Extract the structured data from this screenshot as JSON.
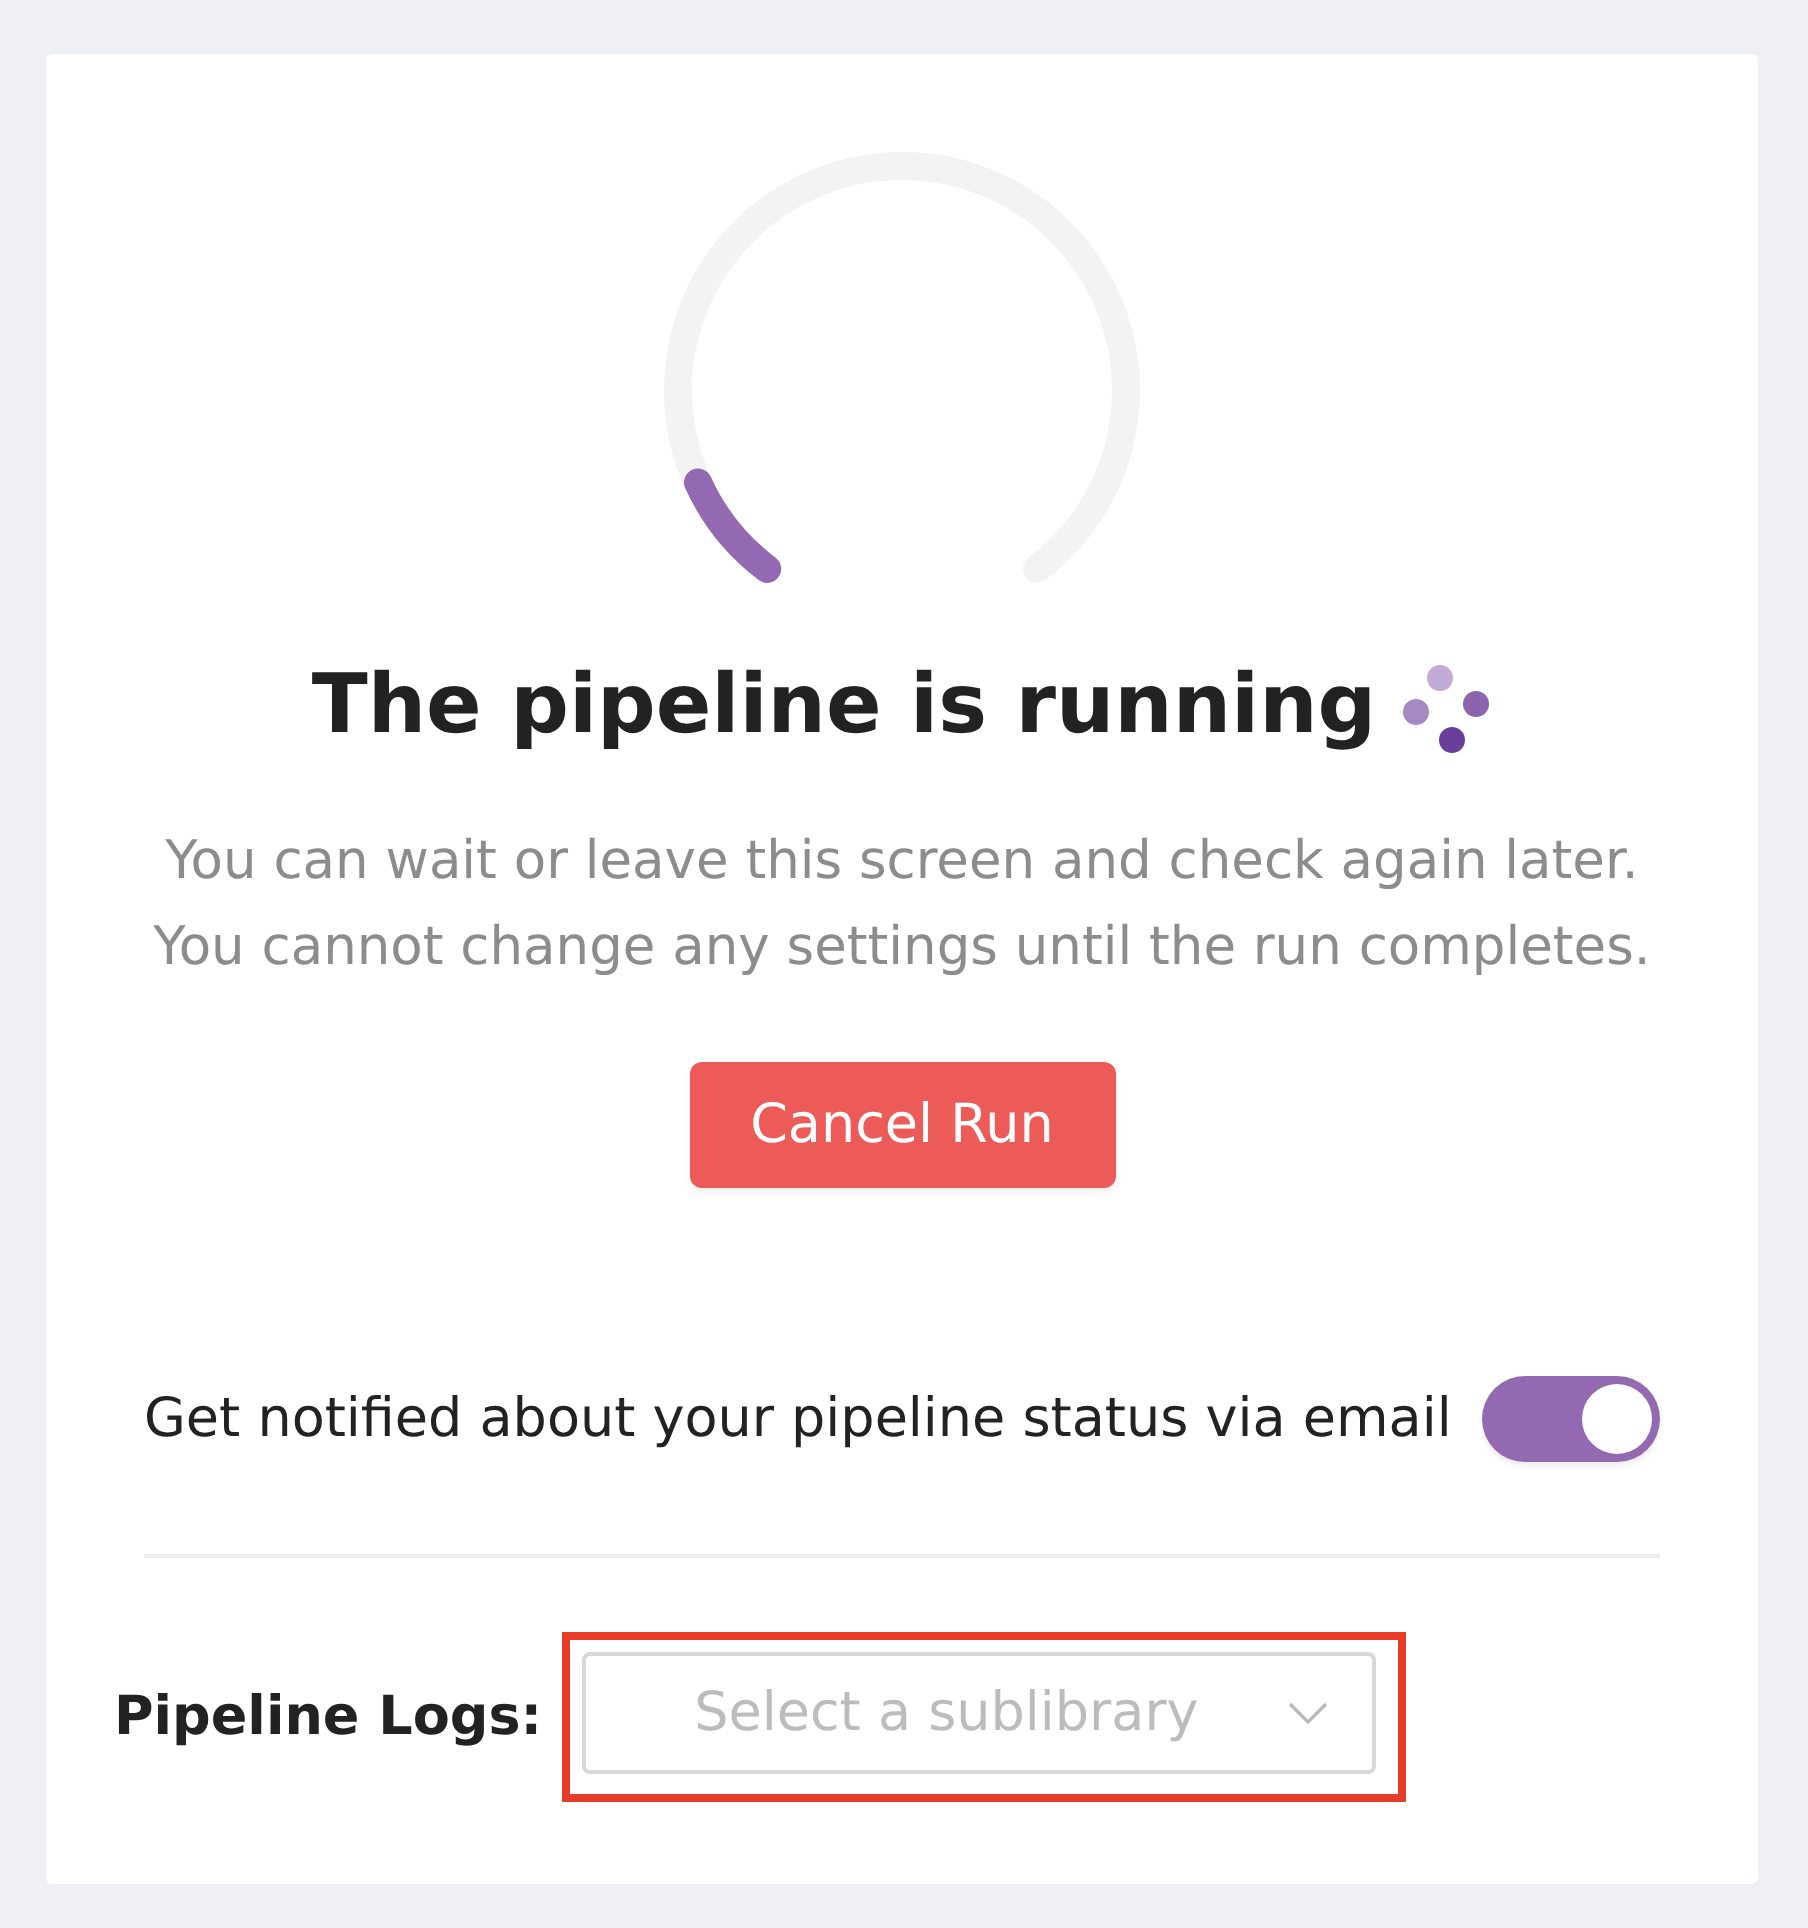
{
  "progress": {
    "level": 0.1
  },
  "heading": {
    "title": "The pipeline is running"
  },
  "message": [
    "You can wait or leave this screen and check again later.",
    "You cannot change any settings until the run completes."
  ],
  "cancel_button": {
    "label": "Cancel Run"
  },
  "email_notification": {
    "label": "Get notified about your pipeline status via email",
    "on": true
  },
  "logs": {
    "label": "Pipeline Logs:",
    "select": {
      "placeholder": "Select a sublibrary",
      "highlighted": true
    }
  }
}
